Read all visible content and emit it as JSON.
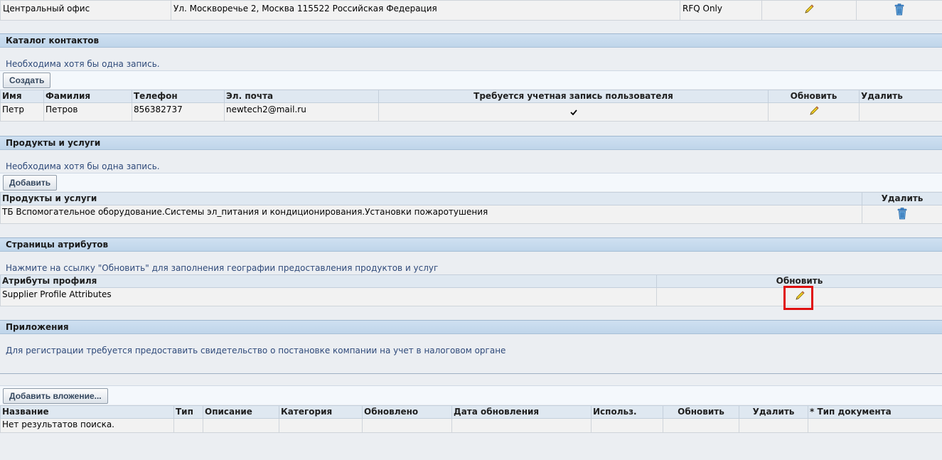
{
  "address_row": {
    "site": "Центральный офис",
    "address": "Ул. Москворечье 2, Москва 115522 Российская Федерация",
    "purpose": "RFQ Only"
  },
  "contacts": {
    "title": "Каталог контактов",
    "hint": "Необходима хотя бы одна запись.",
    "create_label": "Создать",
    "columns": [
      "Имя",
      "Фамилия",
      "Телефон",
      "Эл. почта",
      "Требуется учетная запись пользователя",
      "Обновить",
      "Удалить"
    ],
    "rows": [
      {
        "first_name": "Петр",
        "last_name": "Петров",
        "phone": "856382737",
        "email": "newtech2@mail.ru",
        "account_required": true
      }
    ]
  },
  "products": {
    "title": "Продукты и услуги",
    "hint": "Необходима хотя бы одна запись.",
    "add_label": "Добавить",
    "columns": [
      "Продукты и услуги",
      "Удалить"
    ],
    "rows": [
      {
        "name": "ТБ Вспомогательное оборудование.Системы эл_питания и кондиционирования.Установки пожаротушения"
      }
    ]
  },
  "attributes": {
    "title": "Страницы атрибутов",
    "hint": "Нажмите на ссылку \"Обновить\" для заполнения географии предоставления продуктов и услуг",
    "columns": [
      "Атрибуты профиля",
      "Обновить"
    ],
    "rows": [
      {
        "name": "Supplier Profile Attributes"
      }
    ]
  },
  "attachments": {
    "title": "Приложения",
    "hint": "Для регистрации требуется предоставить свидетельство о постановке компании на учет в налоговом органе",
    "add_label": "Добавить вложение...",
    "columns": [
      "Название",
      "Тип",
      "Описание",
      "Категория",
      "Обновлено",
      "Дата обновления",
      "Использ.",
      "Обновить",
      "Удалить",
      "* Тип документа"
    ],
    "empty_text": "Нет результатов поиска."
  },
  "icons": {
    "update": "pencil-icon",
    "delete": "trash-icon",
    "check": "checkmark-icon"
  },
  "colors": {
    "header_bg": "#c7dbee",
    "highlight": "#e01010",
    "hint_text": "#2f4a7a"
  }
}
